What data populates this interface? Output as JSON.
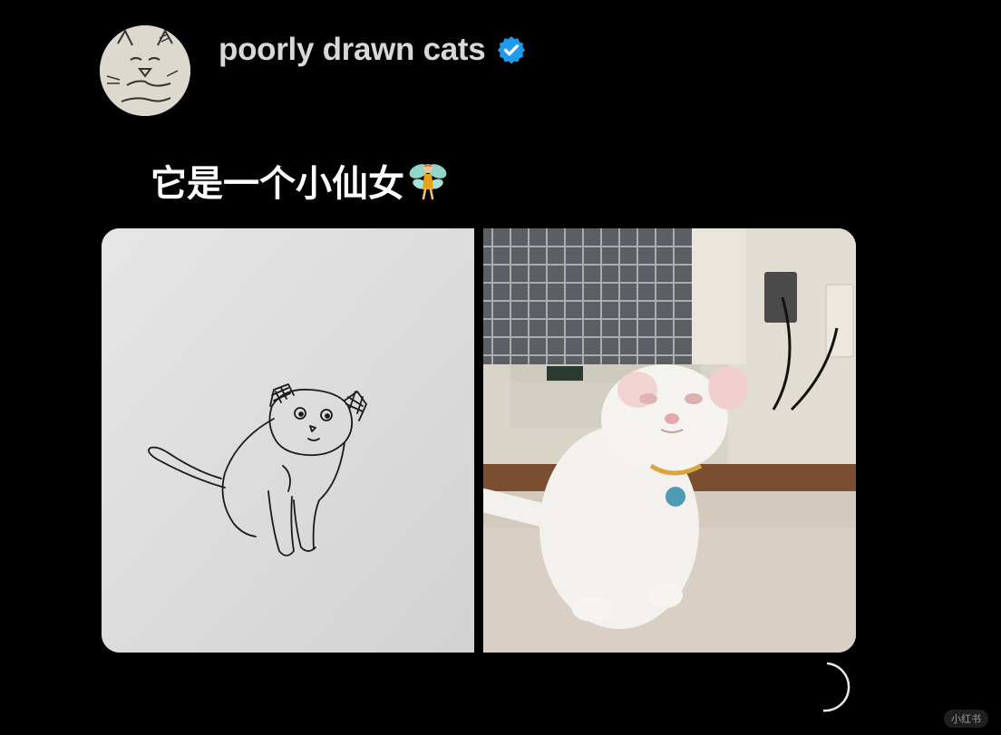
{
  "profile": {
    "display_name": "poorly drawn cats",
    "verified_icon": "verified-badge-icon",
    "avatar_icon": "sketch-cat-face-avatar"
  },
  "post": {
    "text": "它是一个小仙女",
    "emoji": "fairy-emoji"
  },
  "media": [
    {
      "kind": "image",
      "description_icon": "cat-line-drawing-image"
    },
    {
      "kind": "image",
      "description_icon": "white-cat-photo-image"
    }
  ],
  "watermark": {
    "text": "小红书"
  },
  "colors": {
    "background": "#000000",
    "name_text": "#d8d8d8",
    "verified_blue": "#1d9bf0",
    "post_text": "#ffffff"
  }
}
